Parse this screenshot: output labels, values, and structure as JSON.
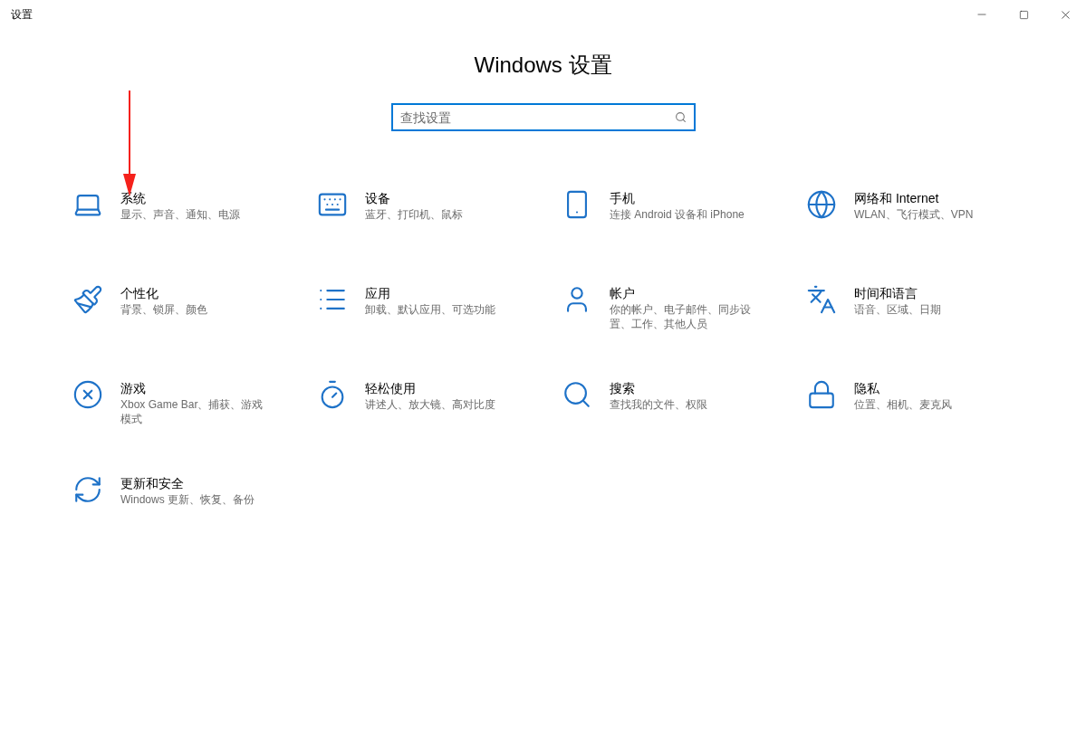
{
  "window": {
    "title": "设置"
  },
  "heading": "Windows 设置",
  "search": {
    "placeholder": "查找设置"
  },
  "categories": [
    {
      "title": "系统",
      "description": "显示、声音、通知、电源"
    },
    {
      "title": "设备",
      "description": "蓝牙、打印机、鼠标"
    },
    {
      "title": "手机",
      "description": "连接 Android 设备和 iPhone"
    },
    {
      "title": "网络和 Internet",
      "description": "WLAN、飞行模式、VPN"
    },
    {
      "title": "个性化",
      "description": "背景、锁屏、颜色"
    },
    {
      "title": "应用",
      "description": "卸载、默认应用、可选功能"
    },
    {
      "title": "帐户",
      "description": "你的帐户、电子邮件、同步设置、工作、其他人员"
    },
    {
      "title": "时间和语言",
      "description": "语音、区域、日期"
    },
    {
      "title": "游戏",
      "description": "Xbox Game Bar、捕获、游戏模式"
    },
    {
      "title": "轻松使用",
      "description": "讲述人、放大镜、高对比度"
    },
    {
      "title": "搜索",
      "description": "查找我的文件、权限"
    },
    {
      "title": "隐私",
      "description": "位置、相机、麦克风"
    },
    {
      "title": "更新和安全",
      "description": "Windows 更新、恢复、备份"
    }
  ]
}
